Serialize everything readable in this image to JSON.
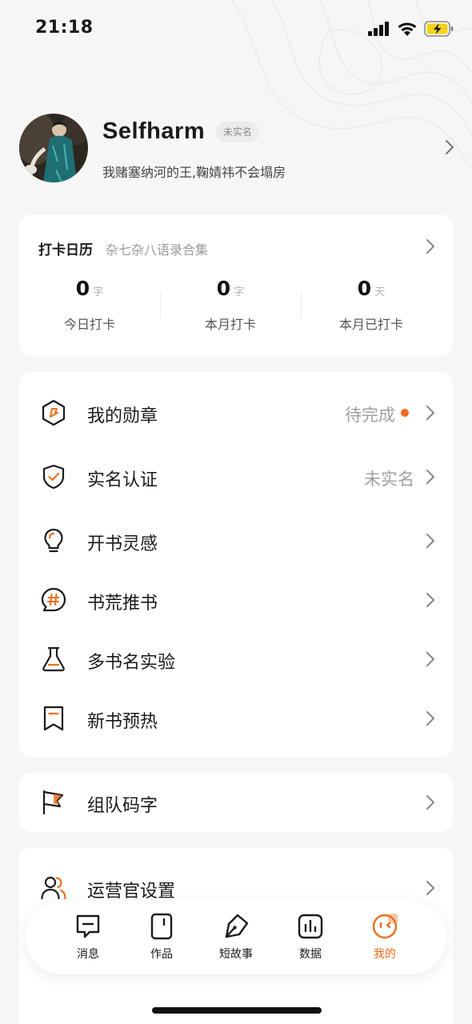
{
  "status_bar": {
    "time": "21:18",
    "battery_color": "#f5d21c"
  },
  "profile": {
    "username": "Selfharm",
    "verify_badge": "未实名",
    "signature": "我赌塞纳河的王,鞠婧祎不会塌房"
  },
  "checkin": {
    "title": "打卡日历",
    "subtitle": "杂七杂八语录合集",
    "stats": [
      {
        "value": "0",
        "unit": "字",
        "label": "今日打卡"
      },
      {
        "value": "0",
        "unit": "字",
        "label": "本月打卡"
      },
      {
        "value": "0",
        "unit": "天",
        "label": "本月已打卡"
      }
    ]
  },
  "menu": {
    "items": [
      {
        "label": "我的勋章",
        "right_text": "待完成",
        "icon": "badge-hexagon-icon"
      },
      {
        "label": "实名认证",
        "right_text": "未实名",
        "icon": "shield-check-icon"
      },
      {
        "label": "开书灵感",
        "icon": "lightbulb-icon"
      },
      {
        "label": "书荒推书",
        "icon": "hashtag-bubble-icon"
      },
      {
        "label": "多书名实验",
        "icon": "flask-icon"
      },
      {
        "label": "新书预热",
        "icon": "bookmark-icon"
      }
    ]
  },
  "team": {
    "label": "组队码字",
    "icon": "flag-icon"
  },
  "ops": {
    "label": "运营官设置",
    "icon": "users-icon"
  },
  "tabbar": {
    "items": [
      {
        "label": "消息",
        "icon": "message-icon"
      },
      {
        "label": "作品",
        "icon": "works-icon"
      },
      {
        "label": "短故事",
        "icon": "pen-icon"
      },
      {
        "label": "数据",
        "icon": "chart-icon"
      },
      {
        "label": "我的",
        "icon": "face-icon",
        "active": true
      }
    ]
  },
  "colors": {
    "accent": "#e8701e",
    "dot": "#f06a1d",
    "background": "#f6f6f6",
    "card": "#ffffff"
  }
}
